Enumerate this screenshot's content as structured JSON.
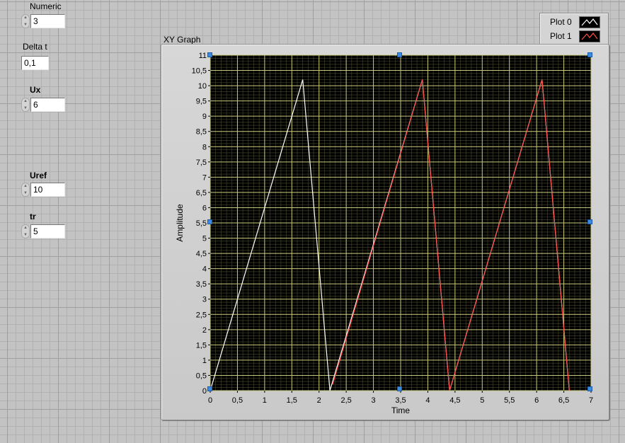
{
  "controls": {
    "numeric": {
      "label": "Numeric",
      "value": "3"
    },
    "delta_t": {
      "label": "Delta t",
      "value": "0,1"
    },
    "ux": {
      "label": "Ux",
      "value": "6"
    },
    "uref": {
      "label": "Uref",
      "value": "10"
    },
    "tr": {
      "label": "tr",
      "value": "5"
    }
  },
  "graph": {
    "title": "XY Graph",
    "legend": [
      "Plot 0",
      "Plot 1"
    ]
  },
  "colors": {
    "plot_background": "#000000",
    "grid": "#c7c77a",
    "plot0": "#ffffff",
    "plot1": "#ff4b4b"
  },
  "icons": {
    "spinner": "up-down-arrows-icon",
    "handle": "resize-handle-icon"
  },
  "chart_data": {
    "type": "line",
    "title": "",
    "xlabel": "Time",
    "ylabel": "Amplitude",
    "xlim": [
      0,
      7
    ],
    "ylim": [
      0,
      11
    ],
    "x_ticks": [
      "0",
      "0,5",
      "1",
      "1,5",
      "2",
      "2,5",
      "3",
      "3,5",
      "4",
      "4,5",
      "5",
      "5,5",
      "6",
      "6,5",
      "7"
    ],
    "y_ticks": [
      "0",
      "0,5",
      "1",
      "1,5",
      "2",
      "2,5",
      "3",
      "3,5",
      "4",
      "4,5",
      "5",
      "5,5",
      "6",
      "6,5",
      "7",
      "7,5",
      "8",
      "8,5",
      "9",
      "9,5",
      "10",
      "10,5",
      "11"
    ],
    "grid": true,
    "legend_position": "top-right",
    "series": [
      {
        "name": "Plot 0",
        "color": "#ffffff",
        "points": [
          [
            0,
            0
          ],
          [
            1.7,
            10.2
          ],
          [
            2.2,
            0
          ],
          [
            3.9,
            10.2
          ],
          [
            4.4,
            0
          ],
          [
            6.1,
            10.2
          ],
          [
            6.6,
            0
          ]
        ]
      },
      {
        "name": "Plot 1",
        "color": "#ff4b4b",
        "points": [
          [
            2.25,
            0.2
          ],
          [
            3.9,
            10.2
          ],
          [
            4.4,
            0
          ],
          [
            6.1,
            10.2
          ],
          [
            6.6,
            0
          ]
        ]
      }
    ]
  }
}
